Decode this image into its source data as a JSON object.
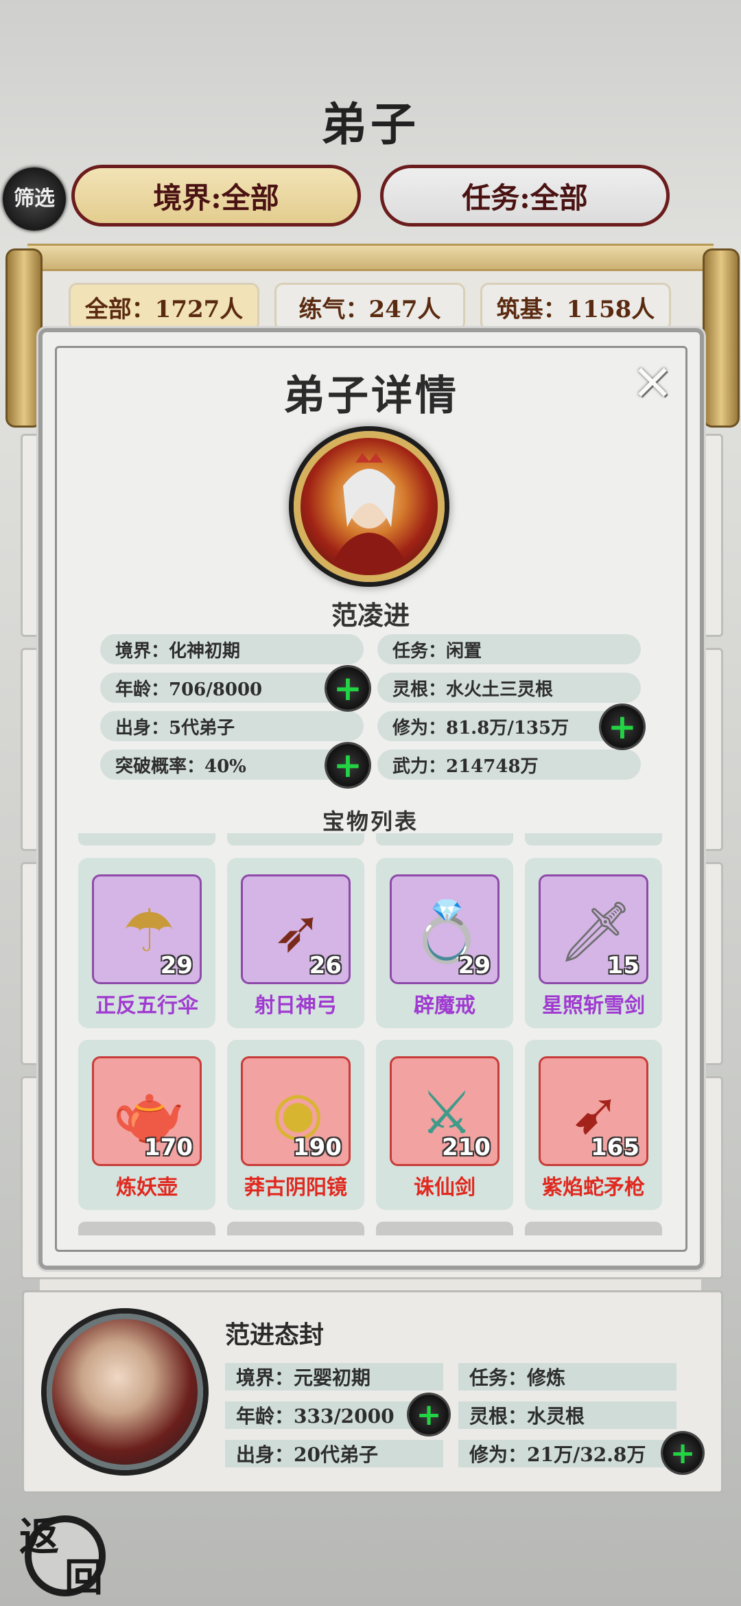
{
  "header": {
    "title": "弟子",
    "filter_badge": "筛选",
    "realm_filter": "境界:全部",
    "task_filter": "任务:全部"
  },
  "counts": [
    {
      "label": "全部：1727人"
    },
    {
      "label": "练气：247人"
    },
    {
      "label": "筑基：1158人"
    }
  ],
  "modal": {
    "title": "弟子详情",
    "close_icon": "×",
    "name": "范凌进",
    "info_left": [
      {
        "text": "境界：化神初期",
        "has_plus": false
      },
      {
        "text": "年龄：706/8000",
        "has_plus": true
      },
      {
        "text": "出身：5代弟子",
        "has_plus": false
      },
      {
        "text": "突破概率：40%",
        "has_plus": true
      }
    ],
    "info_right": [
      {
        "text": "任务：闲置",
        "has_plus": false
      },
      {
        "text": "灵根：水火土三灵根",
        "has_plus": false
      },
      {
        "text": "修为：81.8万/135万",
        "has_plus": true
      },
      {
        "text": "武力：214748万",
        "has_plus": false
      }
    ],
    "plus_symbol": "+",
    "treasure_title": "宝物列表",
    "treasures": [
      {
        "name": "正反五行伞",
        "count": "29",
        "rarity": "purple",
        "icon": "umbrella-icon",
        "glyph": "☂"
      },
      {
        "name": "射日神弓",
        "count": "26",
        "rarity": "purple",
        "icon": "bow-icon",
        "glyph": "➶"
      },
      {
        "name": "辟魔戒",
        "count": "29",
        "rarity": "purple",
        "icon": "ring-icon",
        "glyph": "💍"
      },
      {
        "name": "星照斩雪剑",
        "count": "15",
        "rarity": "purple",
        "icon": "sword-icon",
        "glyph": "🗡"
      },
      {
        "name": "炼妖壶",
        "count": "170",
        "rarity": "red",
        "icon": "teapot-icon",
        "glyph": "🫖"
      },
      {
        "name": "莽古阴阳镜",
        "count": "190",
        "rarity": "red",
        "icon": "mirror-icon",
        "glyph": "◉"
      },
      {
        "name": "诛仙剑",
        "count": "210",
        "rarity": "red",
        "icon": "jade-sword-icon",
        "glyph": "⚔"
      },
      {
        "name": "紫焰蛇矛枪",
        "count": "165",
        "rarity": "red",
        "icon": "spear-icon",
        "glyph": "➹"
      }
    ],
    "colors": {
      "purple_name": "#a03ad0",
      "red_name": "#e0281f",
      "plus": "#22d444"
    }
  },
  "card2": {
    "name": "范进态封",
    "info": [
      {
        "text": "境界：元婴初期",
        "has_plus": false
      },
      {
        "text": "任务：修炼",
        "has_plus": false
      },
      {
        "text": "年龄：333/2000",
        "has_plus": true
      },
      {
        "text": "灵根：水灵根",
        "has_plus": false
      },
      {
        "text": "出身：20代弟子",
        "has_plus": false
      },
      {
        "text": "修为：21万/32.8万",
        "has_plus": true
      }
    ]
  },
  "back_button": {
    "char1": "返",
    "char2": "回"
  }
}
